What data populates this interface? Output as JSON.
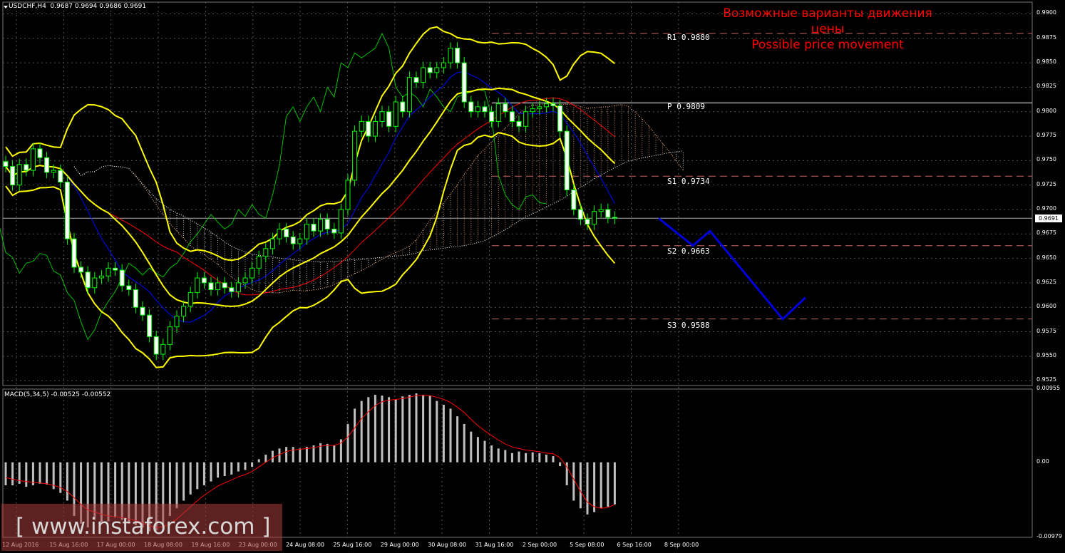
{
  "window": {
    "symbol_header": "USDCHF,H4  0.9687 0.9694 0.9686 0.9691",
    "macd_header": "MACD(5,34,5) -0.00525 -0.00552"
  },
  "title_lines": [
    "Возможные варианты движения цены",
    "Possible price movement"
  ],
  "watermark": "[ www.instaforex.com ]",
  "current_price_label": "0.9691",
  "levels": [
    {
      "name": "R1",
      "label": "R1 0.9880",
      "value": 0.988
    },
    {
      "name": "P",
      "label": "P 0.9809",
      "value": 0.9809
    },
    {
      "name": "S1",
      "label": "S1 0.9734",
      "value": 0.9734
    },
    {
      "name": "S2",
      "label": "S2 0.9663",
      "value": 0.9663
    },
    {
      "name": "S3",
      "label": "S3 0.9588",
      "value": 0.9588
    }
  ],
  "colors": {
    "background": "#000000",
    "grid": "#555555",
    "bollinger": "#ffff00",
    "bull_candle": "#000000",
    "bear_candle": "#ffffff",
    "candle_outline": "#00ff00",
    "kijun": "#ff0000",
    "tenkan": "#0000ff",
    "chikou": "#00c000",
    "cloud_a": "#ffb080",
    "cloud_b": "#ffffff",
    "levels": "#c86464",
    "forecast": "#0000dd",
    "macd_hist": "#c0c0c0",
    "macd_signal": "#ff0000",
    "title": "#ff0000"
  },
  "chart_data": [
    {
      "type": "candlestick",
      "symbol": "USDCHF",
      "timeframe": "H4",
      "ylim": [
        0.952,
        0.9912
      ],
      "y_ticks": [
        "0.9900",
        "0.9875",
        "0.9850",
        "0.9825",
        "0.9800",
        "0.9775",
        "0.9750",
        "0.9725",
        "0.9700",
        "0.9675",
        "0.9650",
        "0.9625",
        "0.9600",
        "0.9575",
        "0.9550",
        "0.9525"
      ],
      "x_ticks": [
        "12 Aug 2016",
        "15 Aug 16:00",
        "17 Aug 00:00",
        "18 Aug 08:00",
        "19 Aug 16:00",
        "23 Aug 00:00",
        "24 Aug 08:00",
        "25 Aug 16:00",
        "29 Aug 00:00",
        "30 Aug 08:00",
        "31 Aug 16:00",
        "2 Sep 00:00",
        "5 Sep 08:00",
        "6 Sep 16:00",
        "8 Sep 00:00"
      ],
      "grid": true,
      "close": [
        0.9744,
        0.9725,
        0.9746,
        0.974,
        0.9762,
        0.9753,
        0.9738,
        0.974,
        0.9728,
        0.967,
        0.9641,
        0.9636,
        0.962,
        0.963,
        0.9632,
        0.964,
        0.9638,
        0.9622,
        0.9618,
        0.96,
        0.9592,
        0.957,
        0.9552,
        0.9562,
        0.958,
        0.9591,
        0.9601,
        0.9615,
        0.963,
        0.9625,
        0.9618,
        0.9625,
        0.962,
        0.9616,
        0.9625,
        0.963,
        0.964,
        0.9652,
        0.966,
        0.967,
        0.968,
        0.9672,
        0.9665,
        0.967,
        0.9685,
        0.9678,
        0.969,
        0.968,
        0.9676,
        0.97,
        0.973,
        0.978,
        0.979,
        0.9775,
        0.979,
        0.98,
        0.9785,
        0.981,
        0.98,
        0.9835,
        0.983,
        0.9845,
        0.984,
        0.9845,
        0.985,
        0.9865,
        0.985,
        0.981,
        0.98,
        0.9805,
        0.98,
        0.979,
        0.9808,
        0.98,
        0.979,
        0.9785,
        0.98,
        0.9803,
        0.9805,
        0.9808,
        0.9806,
        0.978,
        0.972,
        0.97,
        0.969,
        0.9685,
        0.9698,
        0.97,
        0.9692,
        0.9691
      ],
      "pivot_levels": {
        "R1": 0.988,
        "P": 0.9809,
        "S1": 0.9734,
        "S2": 0.9663,
        "S3": 0.9588
      },
      "current_price": 0.9691,
      "forecast_path": [
        0.9691,
        0.9663,
        0.9678,
        0.9588,
        0.961
      ]
    },
    {
      "type": "bar",
      "indicator": "MACD(5,34,5)",
      "main": -0.00525,
      "signal": -0.00552,
      "ylim": [
        -0.00979,
        0.00955
      ],
      "y_ticks": [
        "0.00955",
        "0.00",
        "-0.00979"
      ],
      "values": [
        -0.003,
        -0.003,
        -0.0028,
        -0.0032,
        -0.003,
        -0.0028,
        -0.0029,
        -0.0035,
        -0.004,
        -0.005,
        -0.007,
        -0.008,
        -0.0085,
        -0.0075,
        -0.0078,
        -0.0077,
        -0.0072,
        -0.0075,
        -0.008,
        -0.0082,
        -0.0085,
        -0.009,
        -0.0089,
        -0.008,
        -0.007,
        -0.006,
        -0.005,
        -0.0042,
        -0.0035,
        -0.003,
        -0.0025,
        -0.002,
        -0.0018,
        -0.0016,
        -0.0012,
        -0.001,
        -0.0006,
        0.0004,
        0.001,
        0.0015,
        0.0018,
        0.002,
        0.002,
        0.0018,
        0.002,
        0.0022,
        0.0025,
        0.0024,
        0.0022,
        0.003,
        0.005,
        0.007,
        0.008,
        0.0085,
        0.0088,
        0.0087,
        0.0085,
        0.0082,
        0.0086,
        0.0088,
        0.009,
        0.0088,
        0.0087,
        0.008,
        0.0075,
        0.007,
        0.006,
        0.005,
        0.004,
        0.0033,
        0.0028,
        0.0022,
        0.0018,
        0.0016,
        0.0012,
        0.0014,
        0.0012,
        0.0013,
        0.0012,
        0.001,
        0.0008,
        -0.0005,
        -0.003,
        -0.005,
        -0.006,
        -0.0068,
        -0.0065,
        -0.006,
        -0.0058,
        -0.0055
      ],
      "signal_line": [
        -0.002,
        -0.0022,
        -0.0024,
        -0.0025,
        -0.0026,
        -0.0027,
        -0.0028,
        -0.003,
        -0.0033,
        -0.0038,
        -0.0046,
        -0.0055,
        -0.0062,
        -0.0065,
        -0.0068,
        -0.007,
        -0.0071,
        -0.0072,
        -0.0074,
        -0.0076,
        -0.0079,
        -0.0083,
        -0.0085,
        -0.0084,
        -0.008,
        -0.0074,
        -0.0066,
        -0.0058,
        -0.005,
        -0.0043,
        -0.0037,
        -0.0031,
        -0.0027,
        -0.0023,
        -0.0019,
        -0.0016,
        -0.0012,
        -0.0006,
        0.0,
        0.0006,
        0.001,
        0.0014,
        0.0016,
        0.0017,
        0.0018,
        0.0019,
        0.0021,
        0.0022,
        0.0022,
        0.0025,
        0.0033,
        0.0045,
        0.0057,
        0.0066,
        0.0074,
        0.0079,
        0.0081,
        0.0082,
        0.0083,
        0.0085,
        0.0087,
        0.0087,
        0.0087,
        0.0085,
        0.0082,
        0.0078,
        0.0072,
        0.0065,
        0.0056,
        0.0048,
        0.0041,
        0.0035,
        0.0029,
        0.0024,
        0.002,
        0.0018,
        0.0016,
        0.0015,
        0.0014,
        0.0012,
        0.0011,
        0.0006,
        -0.0006,
        -0.0022,
        -0.0038,
        -0.0052,
        -0.0058,
        -0.006,
        -0.0059,
        -0.0055
      ]
    }
  ]
}
